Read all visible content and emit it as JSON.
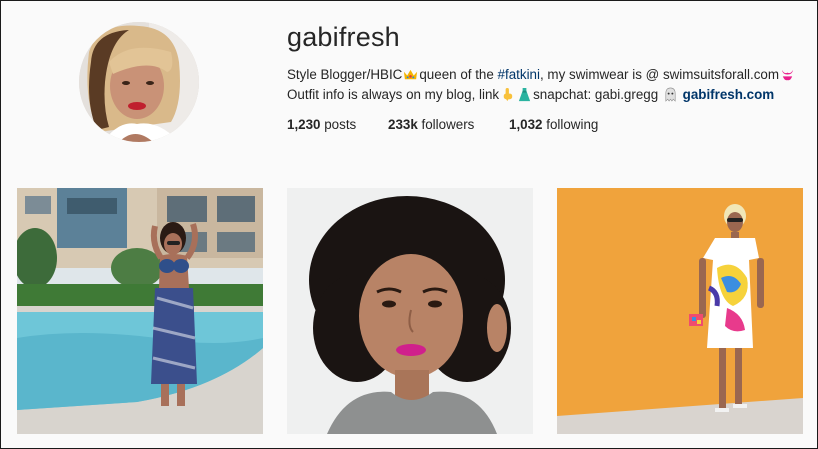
{
  "profile": {
    "username": "gabifresh",
    "bio": {
      "line1_a": "Style Blogger/HBIC",
      "line1_b": "queen of the ",
      "hashtag": "#fatkini",
      "line1_c": ", my swimwear is @ swimsuitsforall.com",
      "line2_a": "Outfit info is always on my blog, link",
      "line2_b": "snapchat: gabi.gregg",
      "website": "gabifresh.com"
    },
    "emojis": [
      "crown-emoji",
      "bikini-emoji",
      "pointing-down-emoji",
      "dress-emoji",
      "ghost-emoji"
    ]
  },
  "stats": {
    "posts_count": "1,230",
    "posts_label": " posts",
    "followers_count": "233k",
    "followers_label": " followers",
    "following_count": "1,032",
    "following_label": " following"
  },
  "posts": [
    {
      "description": "pool-bikini-photo"
    },
    {
      "description": "curly-hair-portrait-photo"
    },
    {
      "description": "orange-wall-dress-photo"
    }
  ],
  "colors": {
    "link": "#003569",
    "text": "#262626",
    "background": "#fafafa"
  }
}
